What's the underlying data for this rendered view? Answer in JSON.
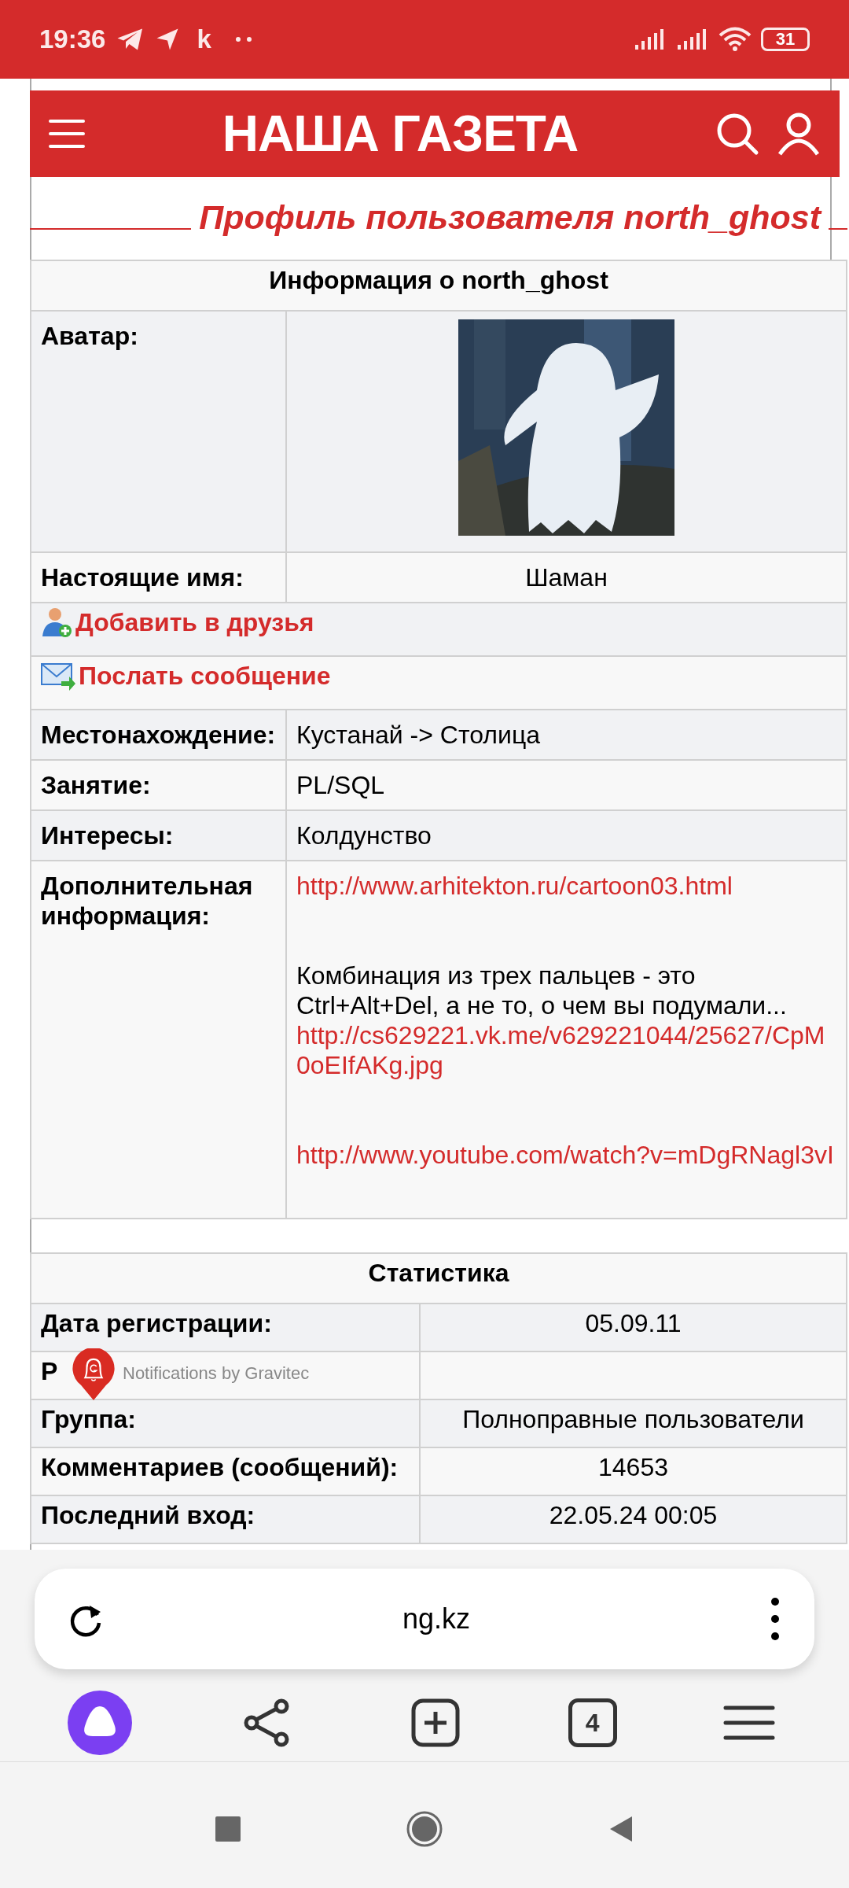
{
  "status_bar": {
    "time": "19:36",
    "letter": "k",
    "battery": "31"
  },
  "site_header": {
    "logo": "НАША ГАЗЕТА"
  },
  "page_title": "Профиль пользователя north_ghost",
  "info_table": {
    "heading": "Информация о north_ghost",
    "rows": [
      {
        "kind": "avatar",
        "label": "Аватар:"
      },
      {
        "kind": "field",
        "label": "Настоящие имя:",
        "value": "Шаман",
        "centered": true
      },
      {
        "kind": "friend_action",
        "text": "Добавить в друзья"
      },
      {
        "kind": "message_action",
        "text": "Послать сообщение"
      },
      {
        "kind": "field",
        "label": "Местонахождение:",
        "value": "Кустанай -> Столица",
        "centered": false
      },
      {
        "kind": "field",
        "label": "Занятие:",
        "value": "PL/SQL",
        "centered": false
      },
      {
        "kind": "field",
        "label": "Интересы:",
        "value": "Колдунство",
        "centered": false
      },
      {
        "kind": "rich",
        "label": "Дополнительная информация:",
        "parts": [
          {
            "kind": "link",
            "text": "http://www.arhitekton.ru/cartoon03.html",
            "gap_after": true
          },
          {
            "kind": "text",
            "text": "Комбинация из трех пальцев - это\nCtrl+Alt+Del, а не то, о чем вы подумали...",
            "gap_after": false
          },
          {
            "kind": "link",
            "text": "http://cs629221.vk.me/v629221044/25627/CpM0oEIfAKg.jpg",
            "gap_after": true
          },
          {
            "kind": "link",
            "text": "http://www.youtube.com/watch?v=mDgRNagl3vI",
            "gap_after": false
          }
        ]
      }
    ]
  },
  "stats_table": {
    "heading": "Статистика",
    "rows": [
      {
        "label": "Дата регистрации:",
        "value": "05.09.11"
      },
      {
        "label": "Р",
        "value": ""
      },
      {
        "label": "Группа:",
        "value": "Полноправные пользователи"
      },
      {
        "label": "Комментариев (сообщений):",
        "value": "14653"
      },
      {
        "label": "Последний вход:",
        "value": "22.05.24 00:05"
      }
    ]
  },
  "notification_badge": {
    "caption": "Notifications by Gravitec"
  },
  "browser": {
    "url": "ng.kz",
    "tab_count": "4"
  }
}
